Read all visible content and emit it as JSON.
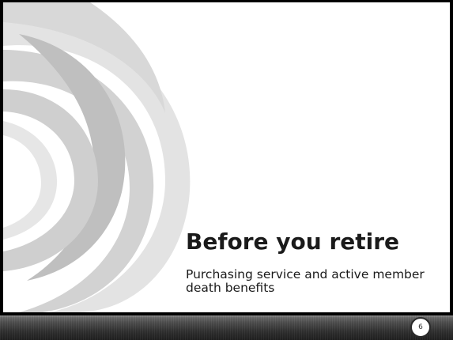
{
  "slide": {
    "title": "Before you retire",
    "subtitle": "Purchasing service and active member death benefits",
    "number": "6"
  },
  "theme": {
    "background": "#ffffff",
    "swirl_gray": "#c8c8c8",
    "footer_dark": "#2a2a2a",
    "text": "#1a1a1a"
  }
}
